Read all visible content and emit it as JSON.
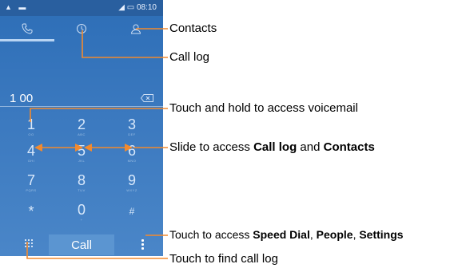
{
  "phone": {
    "status_time": "08:10",
    "dialed_number": "1 00",
    "call_label": "Call",
    "tabs": [
      {
        "icon": "phone-icon"
      },
      {
        "icon": "clock-icon"
      },
      {
        "icon": "person-icon"
      }
    ],
    "keys": [
      {
        "digit": "1",
        "letters": "OO"
      },
      {
        "digit": "2",
        "letters": "ABC"
      },
      {
        "digit": "3",
        "letters": "DEF"
      },
      {
        "digit": "4",
        "letters": "GHI"
      },
      {
        "digit": "5",
        "letters": "JKL"
      },
      {
        "digit": "6",
        "letters": "MNO"
      },
      {
        "digit": "7",
        "letters": "PQRS"
      },
      {
        "digit": "8",
        "letters": "TUV"
      },
      {
        "digit": "9",
        "letters": "WXYZ"
      },
      {
        "digit": "*",
        "letters": ""
      },
      {
        "digit": "0",
        "letters": "+"
      },
      {
        "digit": "#",
        "letters": ""
      }
    ]
  },
  "callouts": {
    "contacts": "Contacts",
    "call_log": "Call log",
    "voicemail": "Touch and hold to access voicemail",
    "slide_prefix": "Slide to access ",
    "slide_b1": "Call log",
    "slide_mid": " and ",
    "slide_b2": "Contacts",
    "menu_prefix": "Touch to access ",
    "menu_b1": "Speed Dial",
    "menu_sep1": ", ",
    "menu_b2": "People",
    "menu_sep2": ", ",
    "menu_b3": "Settings",
    "find_call_log": "Touch to find call log"
  },
  "colors": {
    "phone_bg": "#3b79bf",
    "line": "#f28a2e"
  }
}
